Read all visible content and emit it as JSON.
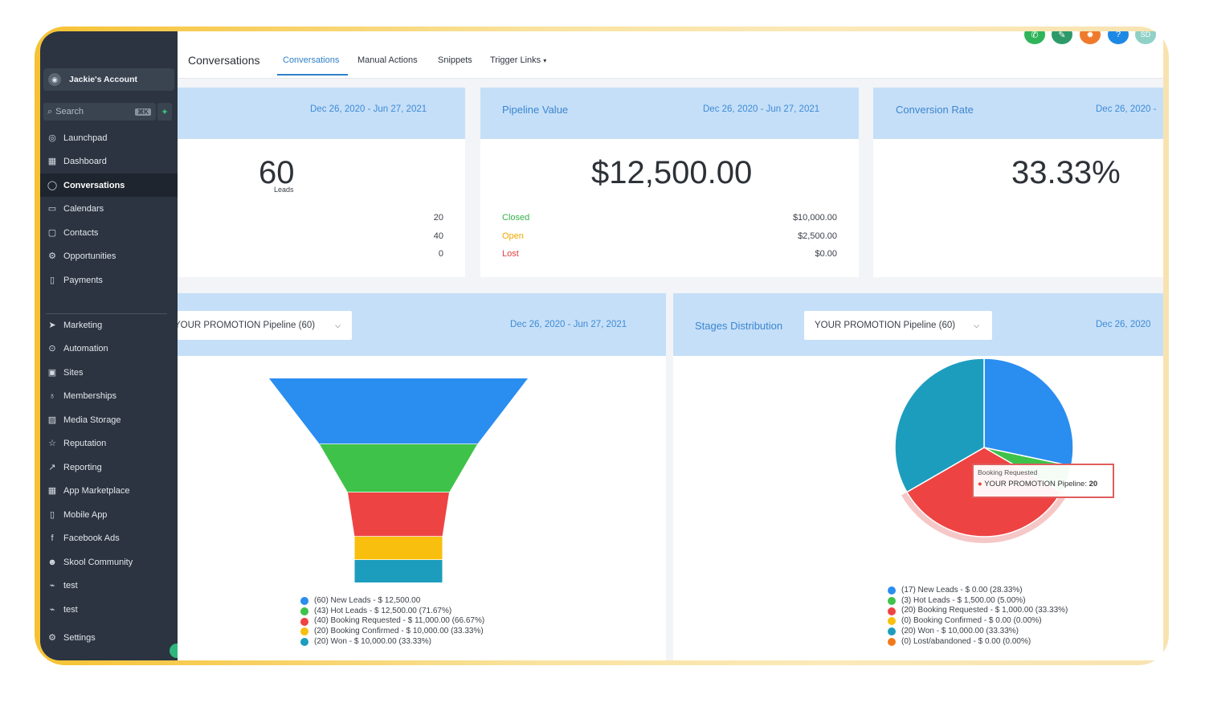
{
  "sidebar": {
    "account": "Jackie's Account",
    "search_placeholder": "Search",
    "search_shortcut": "⌘K",
    "items": [
      {
        "label": "Launchpad",
        "icon": "launchpad-icon",
        "glyph": "◎"
      },
      {
        "label": "Dashboard",
        "icon": "dashboard-icon",
        "glyph": "▦"
      },
      {
        "label": "Conversations",
        "icon": "chat-icon",
        "glyph": "◯",
        "active": true
      },
      {
        "label": "Calendars",
        "icon": "calendar-icon",
        "glyph": "▭"
      },
      {
        "label": "Contacts",
        "icon": "contacts-icon",
        "glyph": "▢"
      },
      {
        "label": "Opportunities",
        "icon": "opportunities-icon",
        "glyph": "⚙"
      },
      {
        "label": "Payments",
        "icon": "payments-icon",
        "glyph": "▯"
      },
      {
        "label": "Marketing",
        "icon": "send-icon",
        "glyph": "➤"
      },
      {
        "label": "Automation",
        "icon": "automation-icon",
        "glyph": "⊙"
      },
      {
        "label": "Sites",
        "icon": "sites-icon",
        "glyph": "▣"
      },
      {
        "label": "Memberships",
        "icon": "membership-icon",
        "glyph": "♁"
      },
      {
        "label": "Media Storage",
        "icon": "image-icon",
        "glyph": "▨"
      },
      {
        "label": "Reputation",
        "icon": "star-icon",
        "glyph": "☆"
      },
      {
        "label": "Reporting",
        "icon": "trend-icon",
        "glyph": "↗"
      },
      {
        "label": "App Marketplace",
        "icon": "apps-icon",
        "glyph": "▦"
      },
      {
        "label": "Mobile App",
        "icon": "mobile-icon",
        "glyph": "▯"
      },
      {
        "label": "Facebook Ads",
        "icon": "facebook-icon",
        "glyph": "f"
      },
      {
        "label": "Skool Community",
        "icon": "community-icon",
        "glyph": "☻"
      },
      {
        "label": "test",
        "icon": "custom-link-icon",
        "glyph": "⌁"
      },
      {
        "label": "test",
        "icon": "custom-link-icon",
        "glyph": "⌁"
      },
      {
        "label": "Settings",
        "icon": "gear-icon",
        "glyph": "⚙"
      }
    ]
  },
  "header": {
    "title": "Conversations",
    "tabs": [
      "Conversations",
      "Manual Actions",
      "Snippets",
      "Trigger Links"
    ],
    "avatar_initials": "SD",
    "top_icons": [
      {
        "name": "phone-icon",
        "color": "#2fb45a",
        "glyph": "✆"
      },
      {
        "name": "megaphone-icon",
        "color": "#2e9a6a",
        "glyph": "✎"
      },
      {
        "name": "notification-icon",
        "color": "#f07a2b",
        "glyph": "✹"
      },
      {
        "name": "help-icon",
        "color": "#1e88e5",
        "glyph": "?"
      },
      {
        "name": "user-avatar",
        "color": "#8fd0c7",
        "glyph": "SD"
      }
    ]
  },
  "cards": {
    "leads": {
      "date": "Dec 26, 2020 - Jun 27, 2021",
      "value": "60",
      "unit": "Leads",
      "rows": [
        "20",
        "40",
        "0"
      ]
    },
    "pipeline": {
      "title": "Pipeline Value",
      "date": "Dec 26, 2020 - Jun 27, 2021",
      "value": "$12,500.00",
      "rows": [
        {
          "label": "Closed",
          "value": "$10,000.00",
          "color": "#35b34a"
        },
        {
          "label": "Open",
          "value": "$2,500.00",
          "color": "#f0a800"
        },
        {
          "label": "Lost",
          "value": "$0.00",
          "color": "#e23d3d"
        }
      ]
    },
    "conversion": {
      "title": "Conversion Rate",
      "date": "Dec 26, 2020 -",
      "value": "33.33%"
    },
    "funnel": {
      "dropdown": "YOUR PROMOTION Pipeline (60)",
      "date": "Dec 26, 2020 - Jun 27, 2021"
    },
    "stages": {
      "title": "Stages Distribution",
      "dropdown": "YOUR PROMOTION Pipeline (60)",
      "date": "Dec 26, 2020",
      "tooltip_title": "Booking Requested",
      "tooltip_series": "YOUR PROMOTION Pipeline:",
      "tooltip_value": "20"
    }
  },
  "chart_data": [
    {
      "type": "funnel",
      "categories": [
        "New Leads",
        "Hot Leads",
        "Booking Requested",
        "Booking Confirmed",
        "Won"
      ],
      "values": [
        60,
        43,
        40,
        20,
        20
      ],
      "colors": [
        "#2a8df0",
        "#3ec24a",
        "#ee4343",
        "#f9bf0e",
        "#1d9dbd"
      ],
      "legend": [
        "(60) New Leads - $ 12,500.00",
        "(43) Hot Leads - $ 12,500.00 (71.67%)",
        "(40) Booking Requested - $ 11,000.00 (66.67%)",
        "(20) Booking Confirmed - $ 10,000.00 (33.33%)",
        "(20) Won - $ 10,000.00 (33.33%)"
      ]
    },
    {
      "type": "pie",
      "categories": [
        "New Leads",
        "Hot Leads",
        "Booking Requested",
        "Booking Confirmed",
        "Won",
        "Lost/abandoned"
      ],
      "values": [
        17,
        3,
        20,
        0,
        20,
        0
      ],
      "colors": [
        "#2a8df0",
        "#3ec24a",
        "#ee4343",
        "#f9bf0e",
        "#1d9dbd",
        "#f07a1a"
      ],
      "legend": [
        "(17) New Leads - $ 0.00 (28.33%)",
        "(3) Hot Leads - $ 1,500.00 (5.00%)",
        "(20) Booking Requested - $ 1,000.00 (33.33%)",
        "(0) Booking Confirmed - $ 0.00 (0.00%)",
        "(20) Won - $ 10,000.00 (33.33%)",
        "(0) Lost/abandoned - $ 0.00 (0.00%)"
      ]
    }
  ]
}
